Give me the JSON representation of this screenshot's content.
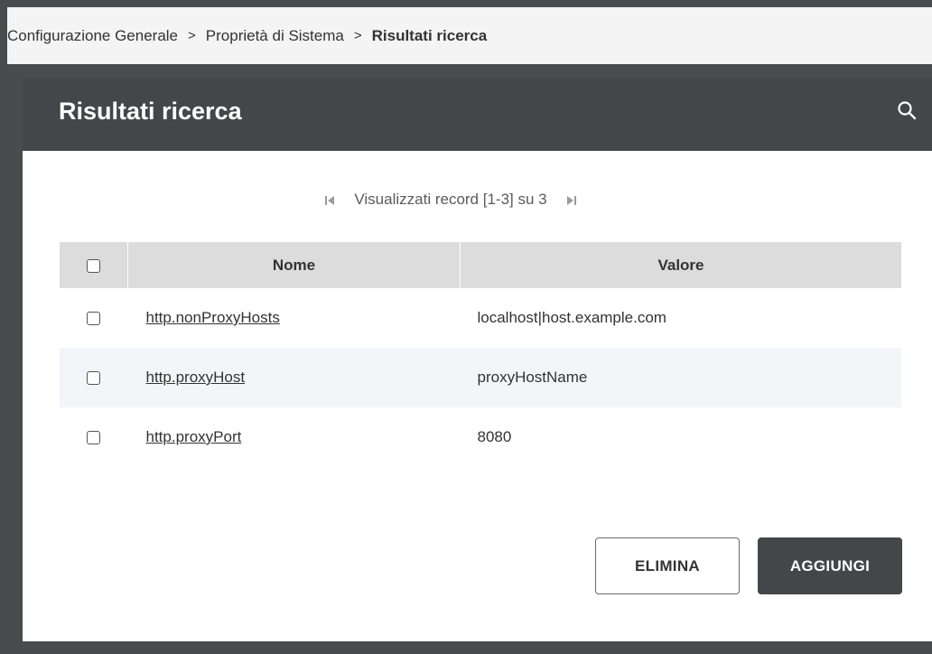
{
  "breadcrumb": {
    "items": [
      "Configurazione Generale",
      "Proprietà di Sistema"
    ],
    "separator": ">",
    "current": "Risultati ricerca"
  },
  "panel": {
    "title": "Risultati ricerca",
    "search_icon": "search-icon"
  },
  "pager": {
    "text": "Visualizzati record [1-3] su 3",
    "first_icon": "first-page-icon",
    "last_icon": "last-page-icon"
  },
  "table": {
    "headers": {
      "nome": "Nome",
      "valore": "Valore"
    },
    "rows": [
      {
        "nome": "http.nonProxyHosts",
        "valore": "localhost|host.example.com"
      },
      {
        "nome": "http.proxyHost",
        "valore": "proxyHostName"
      },
      {
        "nome": "http.proxyPort",
        "valore": "8080"
      }
    ]
  },
  "actions": {
    "delete_label": "ELIMINA",
    "add_label": "AGGIUNGI"
  },
  "colors": {
    "header_dark": "#45464a",
    "table_header_bg": "#dcdcdc",
    "row_alt_bg": "#f4f5f9"
  }
}
